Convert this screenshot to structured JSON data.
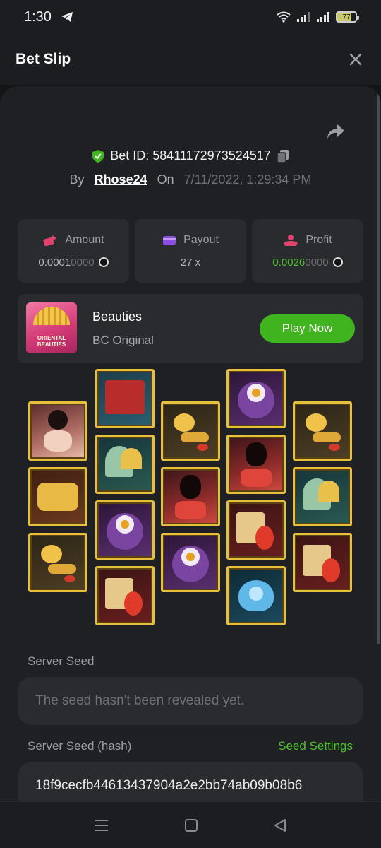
{
  "status_bar": {
    "time": "1:30",
    "battery": "77"
  },
  "header": {
    "title": "Bet Slip"
  },
  "bet": {
    "id_label": "Bet ID: 58411172973524517",
    "by_label": "By",
    "user": "Rhose24",
    "on_label": "On",
    "date": "7/11/2022, 1:29:34 PM"
  },
  "stats": {
    "amount": {
      "label": "Amount",
      "value_main": "0.0001",
      "value_dim": "0000"
    },
    "payout": {
      "label": "Payout",
      "value": "27 x"
    },
    "profit": {
      "label": "Profit",
      "value_main": "0.0026",
      "value_dim": "0000"
    }
  },
  "game": {
    "thumb_text": "ORIENTAL BEAUTIES",
    "name": "Beauties",
    "provider": "BC Original",
    "play_label": "Play Now"
  },
  "reels": [
    [
      "beauty-lady",
      "golden-comb",
      "golden-ruyi"
    ],
    [
      "red-book",
      "jade-fan",
      "purple-lotus-ring",
      "koi-fish-scroll"
    ],
    [
      "golden-ruyi",
      "red-dress-lady",
      "purple-lotus-ring"
    ],
    [
      "purple-lotus-ring",
      "red-dress-lady",
      "koi-fish-scroll",
      "blue-lotus"
    ],
    [
      "golden-ruyi",
      "jade-fan",
      "koi-fish-scroll"
    ]
  ],
  "seeds": {
    "server_seed_label": "Server Seed",
    "server_seed_value": "The seed hasn't been revealed yet.",
    "server_seed_hash_label": "Server Seed (hash)",
    "seed_settings_label": "Seed Settings",
    "server_seed_hash_value": "18f9cecfb44613437904a2e2bb74ab09b08b6"
  },
  "colors": {
    "accent_green": "#3fb41f",
    "gold_frame": "#e6bf3d",
    "panel": "#1f2023",
    "card": "#2a2b2f"
  }
}
